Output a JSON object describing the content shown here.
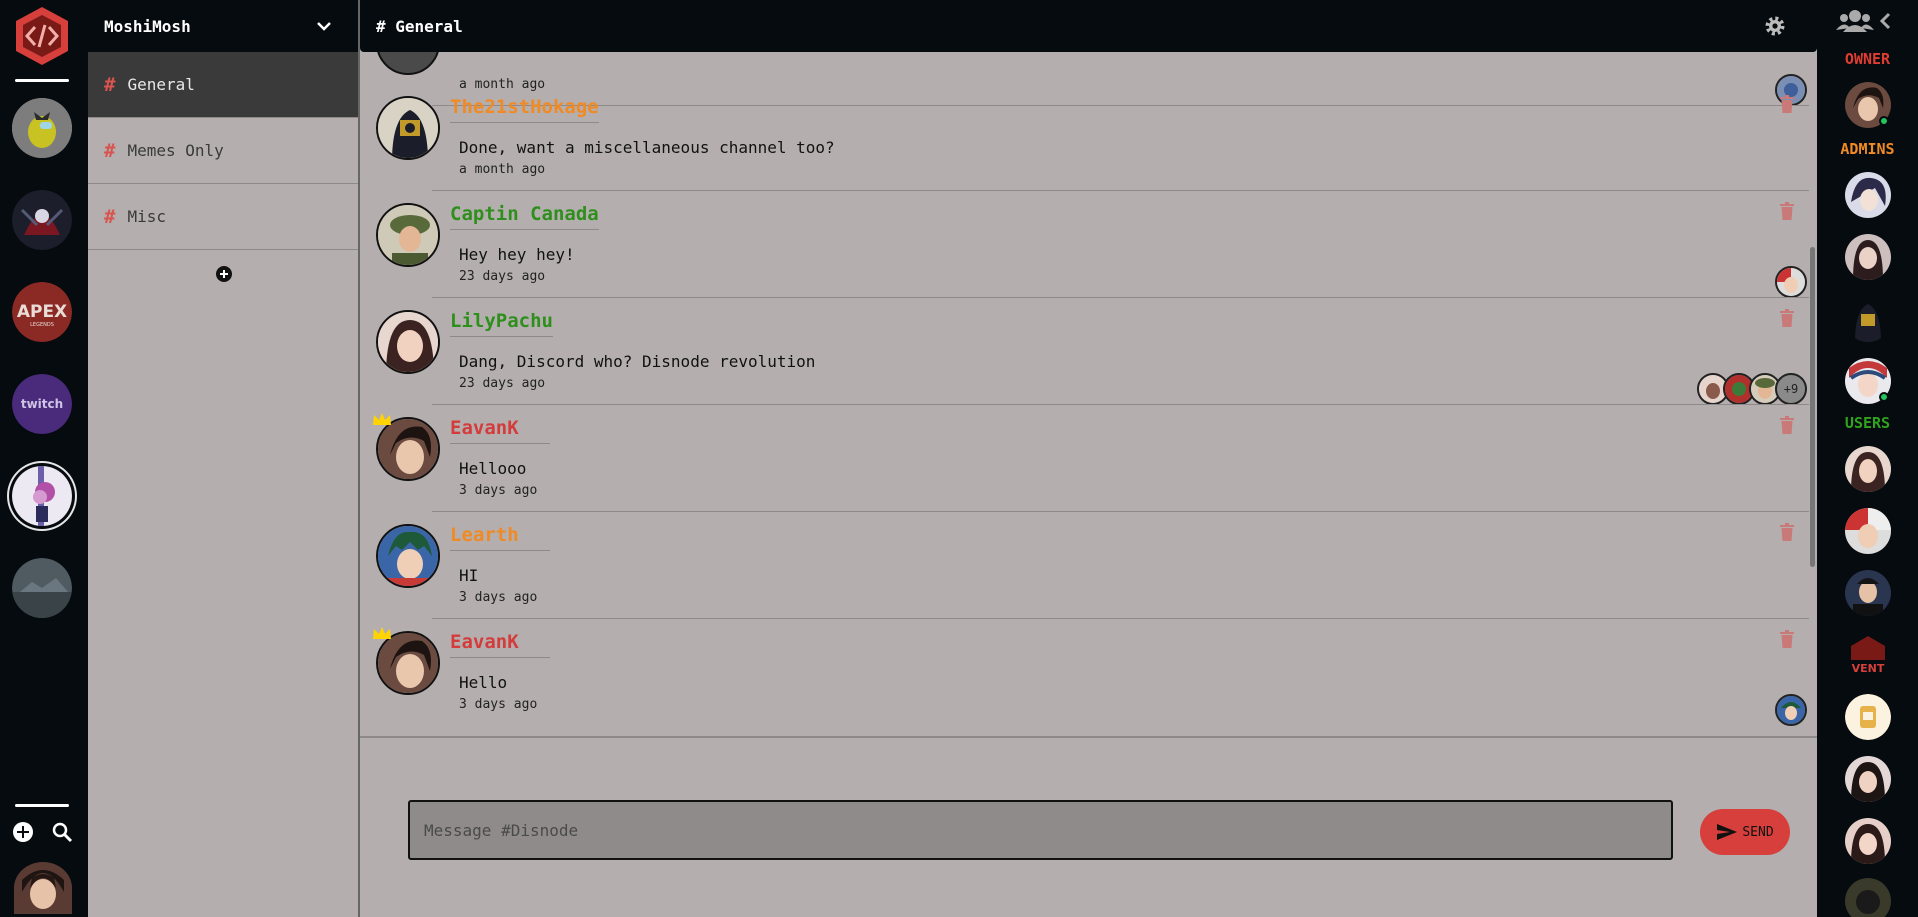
{
  "server": {
    "name": "MoshiMosh"
  },
  "channels": [
    {
      "label": "General",
      "active": true
    },
    {
      "label": "Memes Only",
      "active": false
    },
    {
      "label": "Misc",
      "active": false
    }
  ],
  "header": {
    "channel_title": "# General"
  },
  "messages": [
    {
      "author": "",
      "text": "",
      "time": "a month ago",
      "color": "#f08a24",
      "crown": false,
      "reactions": 1,
      "extra": ""
    },
    {
      "author": "The21stHokage",
      "text": "Done, want a miscellaneous channel too?",
      "time": "a month ago",
      "color": "#f08a24",
      "crown": false,
      "reactions": 0,
      "extra": ""
    },
    {
      "author": "Captin Canada",
      "text": "Hey hey hey!",
      "time": "23 days ago",
      "color": "#2f8f1d",
      "crown": false,
      "reactions": 1,
      "extra": ""
    },
    {
      "author": "LilyPachu",
      "text": "Dang, Discord who? Disnode revolution",
      "time": "23 days ago",
      "color": "#2f8f1d",
      "crown": false,
      "reactions": 3,
      "extra": "+9"
    },
    {
      "author": "EavanK",
      "text": "Hellooo",
      "time": "3 days ago",
      "color": "#d43c3c",
      "crown": true,
      "reactions": 0,
      "extra": ""
    },
    {
      "author": "Learth",
      "text": "HI",
      "time": "3 days ago",
      "color": "#f08a24",
      "crown": false,
      "reactions": 0,
      "extra": ""
    },
    {
      "author": "EavanK",
      "text": "Hello",
      "time": "3 days ago",
      "color": "#d43c3c",
      "crown": true,
      "reactions": 1,
      "extra": ""
    }
  ],
  "composer": {
    "placeholder": "Message #Disnode",
    "send_label": "SEND"
  },
  "members": {
    "owner_label": "OWNER",
    "admins_label": "ADMINS",
    "users_label": "USERS"
  },
  "colors": {
    "accent": "#d63f3b",
    "owner": "#e03c31",
    "admins": "#f08a24",
    "users": "#2fa31d"
  },
  "icons": {
    "logo": "code-brackets-hexagon-icon",
    "add": "plus-circle-icon",
    "search": "search-icon",
    "dropdown": "chevron-down-icon",
    "settings": "gear-icon",
    "delete": "trash-icon",
    "send": "send-icon",
    "members": "users-icon"
  }
}
